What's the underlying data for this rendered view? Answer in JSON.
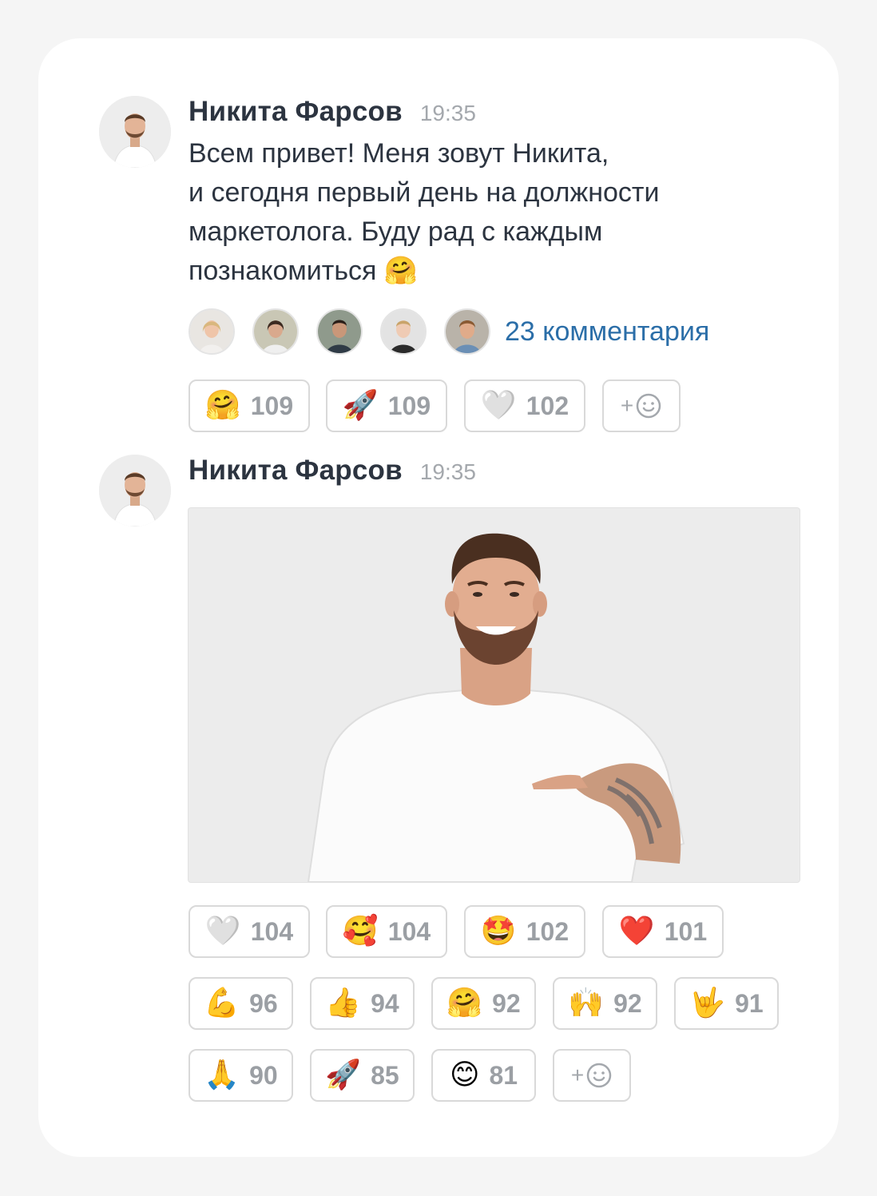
{
  "messages": [
    {
      "author": "Никита Фарсов",
      "time": "19:35",
      "text_lines": [
        "Всем привет! Меня зовут Никита,",
        "и сегодня первый день на должности",
        "маркетолога. Буду рад с каждым",
        "познакомиться"
      ],
      "text_emoji": "🤗",
      "comments_label": "23 комментария",
      "reactions": [
        {
          "emoji": "🤗",
          "count": "109"
        },
        {
          "emoji": "🚀",
          "count": "109"
        },
        {
          "emoji": "🤍",
          "count": "102"
        }
      ],
      "add_reaction": {
        "plus": "+",
        "icon": "☺"
      }
    },
    {
      "author": "Никита Фарсов",
      "time": "19:35",
      "reactions": [
        {
          "emoji": "🤍",
          "count": "104"
        },
        {
          "emoji": "🥰",
          "count": "104"
        },
        {
          "emoji": "🤩",
          "count": "102"
        },
        {
          "emoji": "❤️",
          "count": "101"
        },
        {
          "emoji": "💪",
          "count": "96"
        },
        {
          "emoji": "👍",
          "count": "94"
        },
        {
          "emoji": "🤗",
          "count": "92"
        },
        {
          "emoji": "🙌",
          "count": "92"
        },
        {
          "emoji": "🤟",
          "count": "91"
        },
        {
          "emoji": "🙏",
          "count": "90"
        },
        {
          "emoji": "🚀",
          "count": "85"
        },
        {
          "emoji": "😊",
          "count": "81"
        }
      ],
      "add_reaction": {
        "plus": "+",
        "icon": "☺"
      }
    }
  ],
  "colors": {
    "author": "#2c3440",
    "time": "#a4a8ad",
    "link": "#2b6ea8",
    "count": "#9b9fa4",
    "border": "#d9d9d9"
  }
}
